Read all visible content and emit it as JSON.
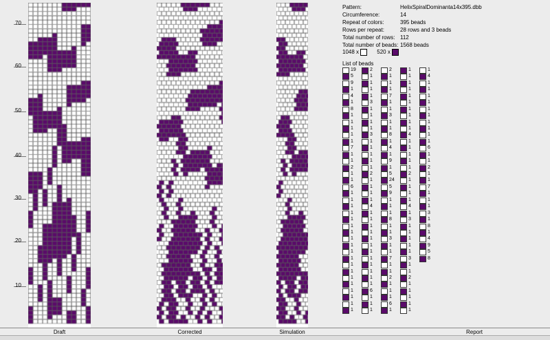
{
  "colors": {
    "purple": "#5a0a6a",
    "white": "#ffffff",
    "grid": "#555555"
  },
  "ruler": {
    "labels": [
      "70",
      "60",
      "50",
      "40",
      "30",
      "20",
      "10"
    ]
  },
  "labels": {
    "draft": "Draft",
    "corrected": "Corrected",
    "simulation": "Simulation",
    "report": "Report"
  },
  "report": {
    "pattern_label": "Pattern:",
    "pattern": "HelixSpiralDominanta14x395.dbb",
    "circ_label": "Circumference:",
    "circ": "14",
    "repeat_label": "Repeat of colors:",
    "repeat": "395 beads",
    "rows_label": "Rows per repeat:",
    "rows": "28 rows and 3 beads",
    "total_rows_label": "Total number of rows:",
    "total_rows": "112",
    "total_beads_label": "Total number of beads:",
    "total_beads": "1568 beads"
  },
  "legend": {
    "white_count": "1048 x",
    "purple_count": "520 x"
  },
  "bead_list_title": "List of beads",
  "bead_columns": [
    {
      "color": "mixed",
      "items": [
        [
          "w",
          "19"
        ],
        [
          "p",
          "5"
        ],
        [
          "w",
          "9"
        ],
        [
          "p",
          "1"
        ],
        [
          "w",
          "4"
        ],
        [
          "p",
          "1"
        ],
        [
          "w",
          "8"
        ],
        [
          "p",
          "1"
        ],
        [
          "w",
          "1"
        ],
        [
          "p",
          "1"
        ],
        [
          "w",
          "1"
        ],
        [
          "p",
          "1"
        ],
        [
          "w",
          "7"
        ],
        [
          "p",
          "1"
        ],
        [
          "w",
          "1"
        ],
        [
          "p",
          "2"
        ],
        [
          "w",
          "1"
        ],
        [
          "p",
          "1"
        ],
        [
          "w",
          "6"
        ],
        [
          "p",
          "1"
        ],
        [
          "w",
          "1"
        ],
        [
          "p",
          "1"
        ],
        [
          "w",
          "1"
        ],
        [
          "p",
          "1"
        ],
        [
          "w",
          "1"
        ],
        [
          "p",
          "1"
        ],
        [
          "w",
          "1"
        ],
        [
          "p",
          "1"
        ],
        [
          "w",
          "1"
        ],
        [
          "p",
          "1"
        ],
        [
          "w",
          "1"
        ],
        [
          "p",
          "1"
        ],
        [
          "w",
          "1"
        ],
        [
          "p",
          "1"
        ],
        [
          "w",
          "1"
        ],
        [
          "p",
          "1"
        ],
        [
          "w",
          "1"
        ],
        [
          "p",
          "1"
        ]
      ]
    },
    {
      "color": "mixed",
      "items": [
        [
          "p",
          "2"
        ],
        [
          "w",
          "1"
        ],
        [
          "p",
          "1"
        ],
        [
          "w",
          "1"
        ],
        [
          "p",
          "1"
        ],
        [
          "w",
          "3"
        ],
        [
          "p",
          "1"
        ],
        [
          "w",
          "1"
        ],
        [
          "p",
          "1"
        ],
        [
          "w",
          "1"
        ],
        [
          "p",
          "3"
        ],
        [
          "w",
          "1"
        ],
        [
          "p",
          "1"
        ],
        [
          "w",
          "1"
        ],
        [
          "p",
          "1"
        ],
        [
          "w",
          "1"
        ],
        [
          "p",
          "2"
        ],
        [
          "w",
          "1"
        ],
        [
          "p",
          "1"
        ],
        [
          "w",
          "1"
        ],
        [
          "p",
          "1"
        ],
        [
          "w",
          "4"
        ],
        [
          "p",
          "1"
        ],
        [
          "w",
          "1"
        ],
        [
          "p",
          "1"
        ],
        [
          "w",
          "1"
        ],
        [
          "p",
          "1"
        ],
        [
          "w",
          "1"
        ],
        [
          "p",
          "1"
        ],
        [
          "w",
          "1"
        ],
        [
          "p",
          "1"
        ],
        [
          "w",
          "1"
        ],
        [
          "p",
          "1"
        ],
        [
          "w",
          "1"
        ],
        [
          "p",
          "6"
        ],
        [
          "w",
          "1"
        ],
        [
          "p",
          "1"
        ],
        [
          "w",
          "1"
        ]
      ]
    },
    {
      "color": "mixed",
      "items": [
        [
          "w",
          "2"
        ],
        [
          "p",
          "1"
        ],
        [
          "w",
          "1"
        ],
        [
          "p",
          "1"
        ],
        [
          "w",
          "7"
        ],
        [
          "p",
          "1"
        ],
        [
          "w",
          "1"
        ],
        [
          "p",
          "3"
        ],
        [
          "w",
          "1"
        ],
        [
          "p",
          "1"
        ],
        [
          "w",
          "8"
        ],
        [
          "p",
          "1"
        ],
        [
          "w",
          "4"
        ],
        [
          "p",
          "1"
        ],
        [
          "w",
          "9"
        ],
        [
          "p",
          "1"
        ],
        [
          "w",
          "5"
        ],
        [
          "p",
          "24"
        ],
        [
          "w",
          "5"
        ],
        [
          "p",
          "9"
        ],
        [
          "w",
          "1"
        ],
        [
          "p",
          "1"
        ],
        [
          "w",
          "1"
        ],
        [
          "p",
          "8"
        ],
        [
          "w",
          "1"
        ],
        [
          "p",
          "1"
        ],
        [
          "w",
          "3"
        ],
        [
          "p",
          "1"
        ],
        [
          "w",
          "1"
        ],
        [
          "p",
          "7"
        ],
        [
          "w",
          "1"
        ],
        [
          "p",
          "1"
        ],
        [
          "w",
          "2"
        ],
        [
          "p",
          "1"
        ],
        [
          "w",
          "1"
        ],
        [
          "p",
          "1"
        ],
        [
          "w",
          "6"
        ],
        [
          "p",
          "1"
        ]
      ]
    },
    {
      "color": "mixed",
      "items": [
        [
          "p",
          "1"
        ],
        [
          "w",
          "1"
        ],
        [
          "p",
          "1"
        ],
        [
          "w",
          "1"
        ],
        [
          "p",
          "1"
        ],
        [
          "w",
          "1"
        ],
        [
          "p",
          "1"
        ],
        [
          "w",
          "1"
        ],
        [
          "p",
          "1"
        ],
        [
          "w",
          "1"
        ],
        [
          "p",
          "4"
        ],
        [
          "w",
          "1"
        ],
        [
          "p",
          "1"
        ],
        [
          "w",
          "1"
        ],
        [
          "p",
          "1"
        ],
        [
          "w",
          "1"
        ],
        [
          "p",
          "2"
        ],
        [
          "w",
          "1"
        ],
        [
          "p",
          "1"
        ],
        [
          "w",
          "1"
        ],
        [
          "p",
          "1"
        ],
        [
          "w",
          "4"
        ],
        [
          "p",
          "1"
        ],
        [
          "w",
          "3"
        ],
        [
          "p",
          "1"
        ],
        [
          "w",
          "1"
        ],
        [
          "p",
          "1"
        ],
        [
          "w",
          "1"
        ],
        [
          "p",
          "1"
        ],
        [
          "w",
          "3"
        ],
        [
          "p",
          "1"
        ],
        [
          "w",
          "1"
        ],
        [
          "p",
          "2"
        ],
        [
          "w",
          "1"
        ],
        [
          "p",
          "1"
        ],
        [
          "w",
          "1"
        ],
        [
          "p",
          "1"
        ],
        [
          "w",
          "1"
        ]
      ]
    },
    {
      "color": "mixed",
      "items": [
        [
          "w",
          "1"
        ],
        [
          "p",
          "4"
        ],
        [
          "w",
          "1"
        ],
        [
          "p",
          "1"
        ],
        [
          "w",
          "1"
        ],
        [
          "p",
          "1"
        ],
        [
          "w",
          "1"
        ],
        [
          "p",
          "1"
        ],
        [
          "w",
          "1"
        ],
        [
          "p",
          "1"
        ],
        [
          "w",
          "1"
        ],
        [
          "p",
          "1"
        ],
        [
          "w",
          "6"
        ],
        [
          "p",
          "1"
        ],
        [
          "w",
          "1"
        ],
        [
          "p",
          "2"
        ],
        [
          "w",
          "1"
        ],
        [
          "p",
          "1"
        ],
        [
          "w",
          "7"
        ],
        [
          "p",
          "1"
        ],
        [
          "w",
          "1"
        ],
        [
          "p",
          "1"
        ],
        [
          "w",
          "3"
        ],
        [
          "p",
          "1"
        ],
        [
          "w",
          "8"
        ],
        [
          "p",
          "1"
        ],
        [
          "w",
          "4"
        ],
        [
          "p",
          "9"
        ],
        [
          "w",
          "5"
        ],
        [
          "p",
          "8"
        ]
      ]
    }
  ]
}
